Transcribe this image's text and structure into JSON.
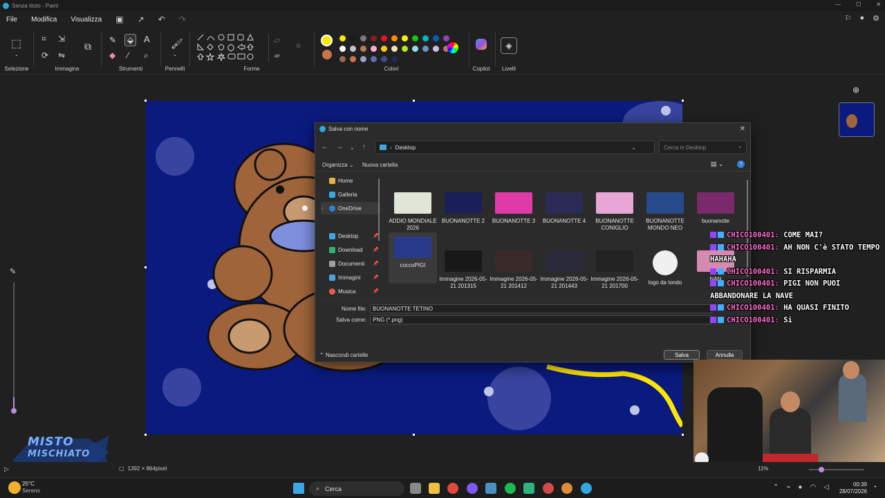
{
  "window": {
    "title": "Senza titolo - Paint"
  },
  "menu": [
    "File",
    "Modifica",
    "Visualizza"
  ],
  "ribbon": {
    "groups": [
      "Selezione",
      "Immagine",
      "Strumenti",
      "Pennelli",
      "Forme",
      "Colori",
      "Copilot",
      "Livelli"
    ],
    "colors": [
      "#ffe600",
      "#1b1b1b",
      "#7a7a7a",
      "#8b1a1a",
      "#e81123",
      "#ff8c00",
      "#fff100",
      "#16c60c",
      "#00b7c3",
      "#0063b1",
      "#8e44ad",
      "#ffffff",
      "#c3c3c3",
      "#b97a57",
      "#ffaec9",
      "#ffc90e",
      "#efe4b0",
      "#b5e61d",
      "#99d9ea",
      "#7092be",
      "#c8bfe7",
      "#b97a57",
      "#9c6b4b",
      "#c8744a",
      "#9aa3c8",
      "#5a6fb0",
      "#3d4f88",
      "#202a55"
    ],
    "active_color": "#ffe600",
    "secondary_color": "#c8744a"
  },
  "dialog": {
    "title": "Salva con nome",
    "address": "Desktop",
    "search_placeholder": "Cerca in Desktop",
    "organize": "Organizza",
    "new_folder": "Nuova cartella",
    "nav": [
      {
        "label": "Home",
        "color": "#e8b04a"
      },
      {
        "label": "Galleria",
        "color": "#3aa6e6"
      },
      {
        "label": "OneDrive",
        "color": "#2f7fd6"
      },
      {
        "label": "Desktop",
        "color": "#3aa6e6",
        "pinned": true
      },
      {
        "label": "Download",
        "color": "#2fb36b",
        "pinned": true
      },
      {
        "label": "Documenti",
        "color": "#9aa0a6",
        "pinned": true
      },
      {
        "label": "Immagini",
        "color": "#4aa3df",
        "pinned": true
      },
      {
        "label": "Musica",
        "color": "#e85a4f",
        "pinned": true
      }
    ],
    "files": [
      {
        "name": "ADDIO MONDIALE 2026",
        "color": "#dfe6d8"
      },
      {
        "name": "BUONANOTTE 2",
        "color": "#1a1f5a"
      },
      {
        "name": "BUONANOTTE 3",
        "color": "#e03aa8"
      },
      {
        "name": "BUONANOTTE 4",
        "color": "#2b2b55"
      },
      {
        "name": "BUONANOTTE CONIGLIO",
        "color": "#e8a6d6"
      },
      {
        "name": "BUONANOTTE MONDO NEO",
        "color": "#274a8a"
      },
      {
        "name": "buonanotte",
        "color": "#7a2a6a"
      },
      {
        "name": "coccoPIGI",
        "color": "#2a3a8a"
      },
      {
        "name": "Immagine 2026-05-21 201315",
        "color": "#181818"
      },
      {
        "name": "Immagine 2026-05-21 201412",
        "color": "#3a2a2a"
      },
      {
        "name": "Immagine 2026-05-21 201443",
        "color": "#2a2a3a"
      },
      {
        "name": "Immagine 2026-05-21 201700",
        "color": "#222"
      },
      {
        "name": "logo da tondo",
        "color": "#f0f0f0"
      },
      {
        "name": "NAN",
        "color": "#d78ab0"
      }
    ],
    "filename_label": "Nome file:",
    "filename_value": "BUONANOTTE TETINO",
    "type_label": "Salva come:",
    "type_value": "PNG (*.png)",
    "hide_folders": "Nascondi cartelle",
    "save": "Salva",
    "cancel": "Annulla"
  },
  "chat": [
    {
      "user": "CHICO100401:",
      "text": "COME MAI?"
    },
    {
      "user": "CHICO100401:",
      "text": "AH NON C'è STATO TEMPO HAHAHA"
    },
    {
      "user": "CHICO100401:",
      "text": "SI RISPARMIA"
    },
    {
      "user": "CHICO100401:",
      "text": "PIGI NON PUOI ABBANDONARE LA NAVE"
    },
    {
      "user": "CHICO100401:",
      "text": "HA QUASI FINITO"
    },
    {
      "user": "CHICO100401:",
      "text": "Si"
    }
  ],
  "status": {
    "dimensions": "1392 × 864pixel",
    "zoom": "11%"
  },
  "taskbar": {
    "weather_temp": "25°C",
    "weather_desc": "Sereno",
    "search": "Cerca",
    "time": "00:39",
    "date": "28/07/2026"
  },
  "overlay_logo": {
    "line1": "MISTO",
    "line2": "MISCHIATO"
  }
}
